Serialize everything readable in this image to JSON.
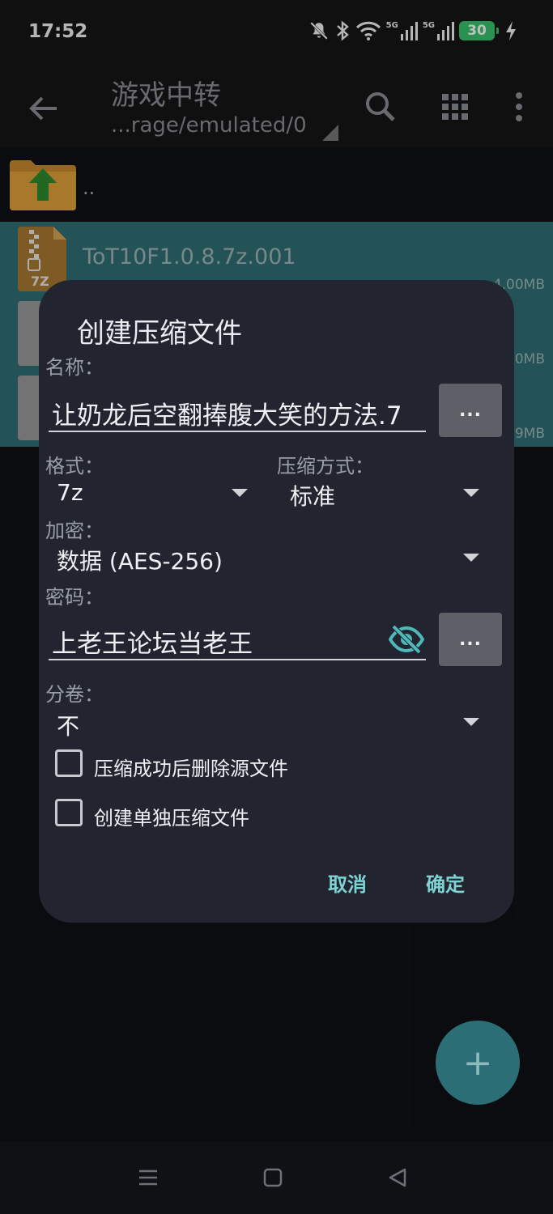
{
  "status": {
    "time": "17:52",
    "net1": "5G",
    "net2": "5G",
    "battery": "30",
    "icons": [
      "mute-bell-icon",
      "bluetooth-icon",
      "wifi-icon",
      "signal-icon",
      "signal-icon",
      "battery-icon",
      "charging-icon"
    ]
  },
  "appbar": {
    "title": "游戏中转",
    "path": "...rage/emulated/0",
    "icons": [
      "back-arrow-icon",
      "search-icon",
      "grid-view-icon",
      "more-vert-icon"
    ]
  },
  "files": {
    "parent_label": "..",
    "items": [
      {
        "name": "ToT10F1.0.8.7z.001",
        "size": "4.00MB",
        "badge": "7Z"
      },
      {
        "name": "",
        "size": "0MB"
      },
      {
        "name": "",
        "size": "9MB"
      }
    ]
  },
  "dialog": {
    "title": "创建压缩文件",
    "name_label": "名称：",
    "name_value": "让奶龙后空翻捧腹大笑的方法.7",
    "dots": "...",
    "format_label": "格式：",
    "format_value": "7z",
    "method_label": "压缩方式：",
    "method_value": "标准",
    "encrypt_label": "加密：",
    "encrypt_value": "数据 (AES-256)",
    "password_label": "密码：",
    "password_value": "上老王论坛当老王",
    "split_label": "分卷：",
    "split_value": "不",
    "check_delete": "压缩成功后删除源文件",
    "check_separate": "创建单独压缩文件",
    "cancel": "取消",
    "ok": "确定"
  },
  "fab": {
    "label": "+"
  },
  "colors": {
    "accent": "#7fd3d3",
    "highlight_row": "#2f6f73",
    "dialog_bg": "#22252f",
    "battery": "#39c36d"
  }
}
